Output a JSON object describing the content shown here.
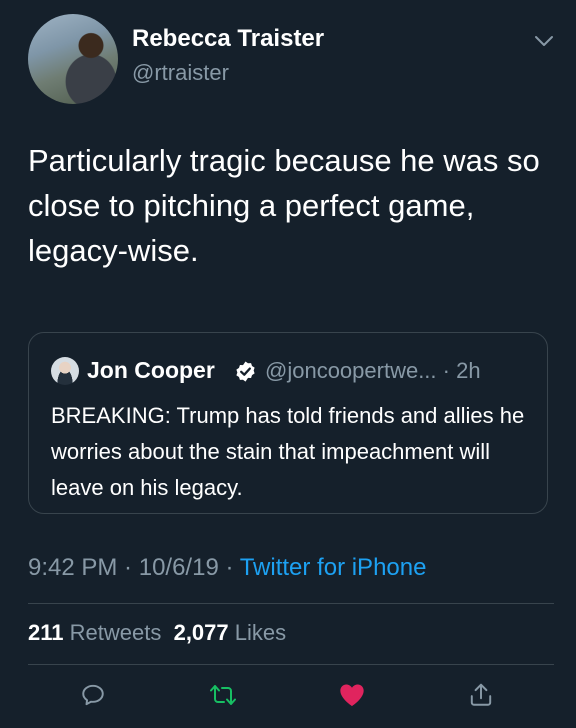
{
  "tweet": {
    "author_name": "Rebecca Traister",
    "author_handle": "@rtraister",
    "text": "Particularly tragic because he was so close to pitching a perfect game, legacy-wise.",
    "time": "9:42 PM",
    "date": "10/6/19",
    "source": "Twitter for iPhone",
    "retweets_count": "211",
    "retweets_label": "Retweets",
    "likes_count": "2,077",
    "likes_label": "Likes"
  },
  "quoted": {
    "author_name": "Jon Cooper",
    "author_handle": "@joncoopertwe...",
    "age": "2h",
    "text": "BREAKING: Trump has told friends and allies he worries about the stain that impeachment will leave on his legacy."
  },
  "icons": {
    "reply": "comment-bubble-icon",
    "retweet": "retweet-arrows-icon",
    "like": "heart-icon",
    "share": "share-arrow-icon",
    "menu": "chevron-down-icon",
    "verified": "verified-badge-icon"
  },
  "colors": {
    "background": "#15202b",
    "secondary_text": "#8899a6",
    "link": "#1da1f2",
    "retweet": "#17bf63",
    "like": "#e0245e",
    "border": "#38444d"
  }
}
